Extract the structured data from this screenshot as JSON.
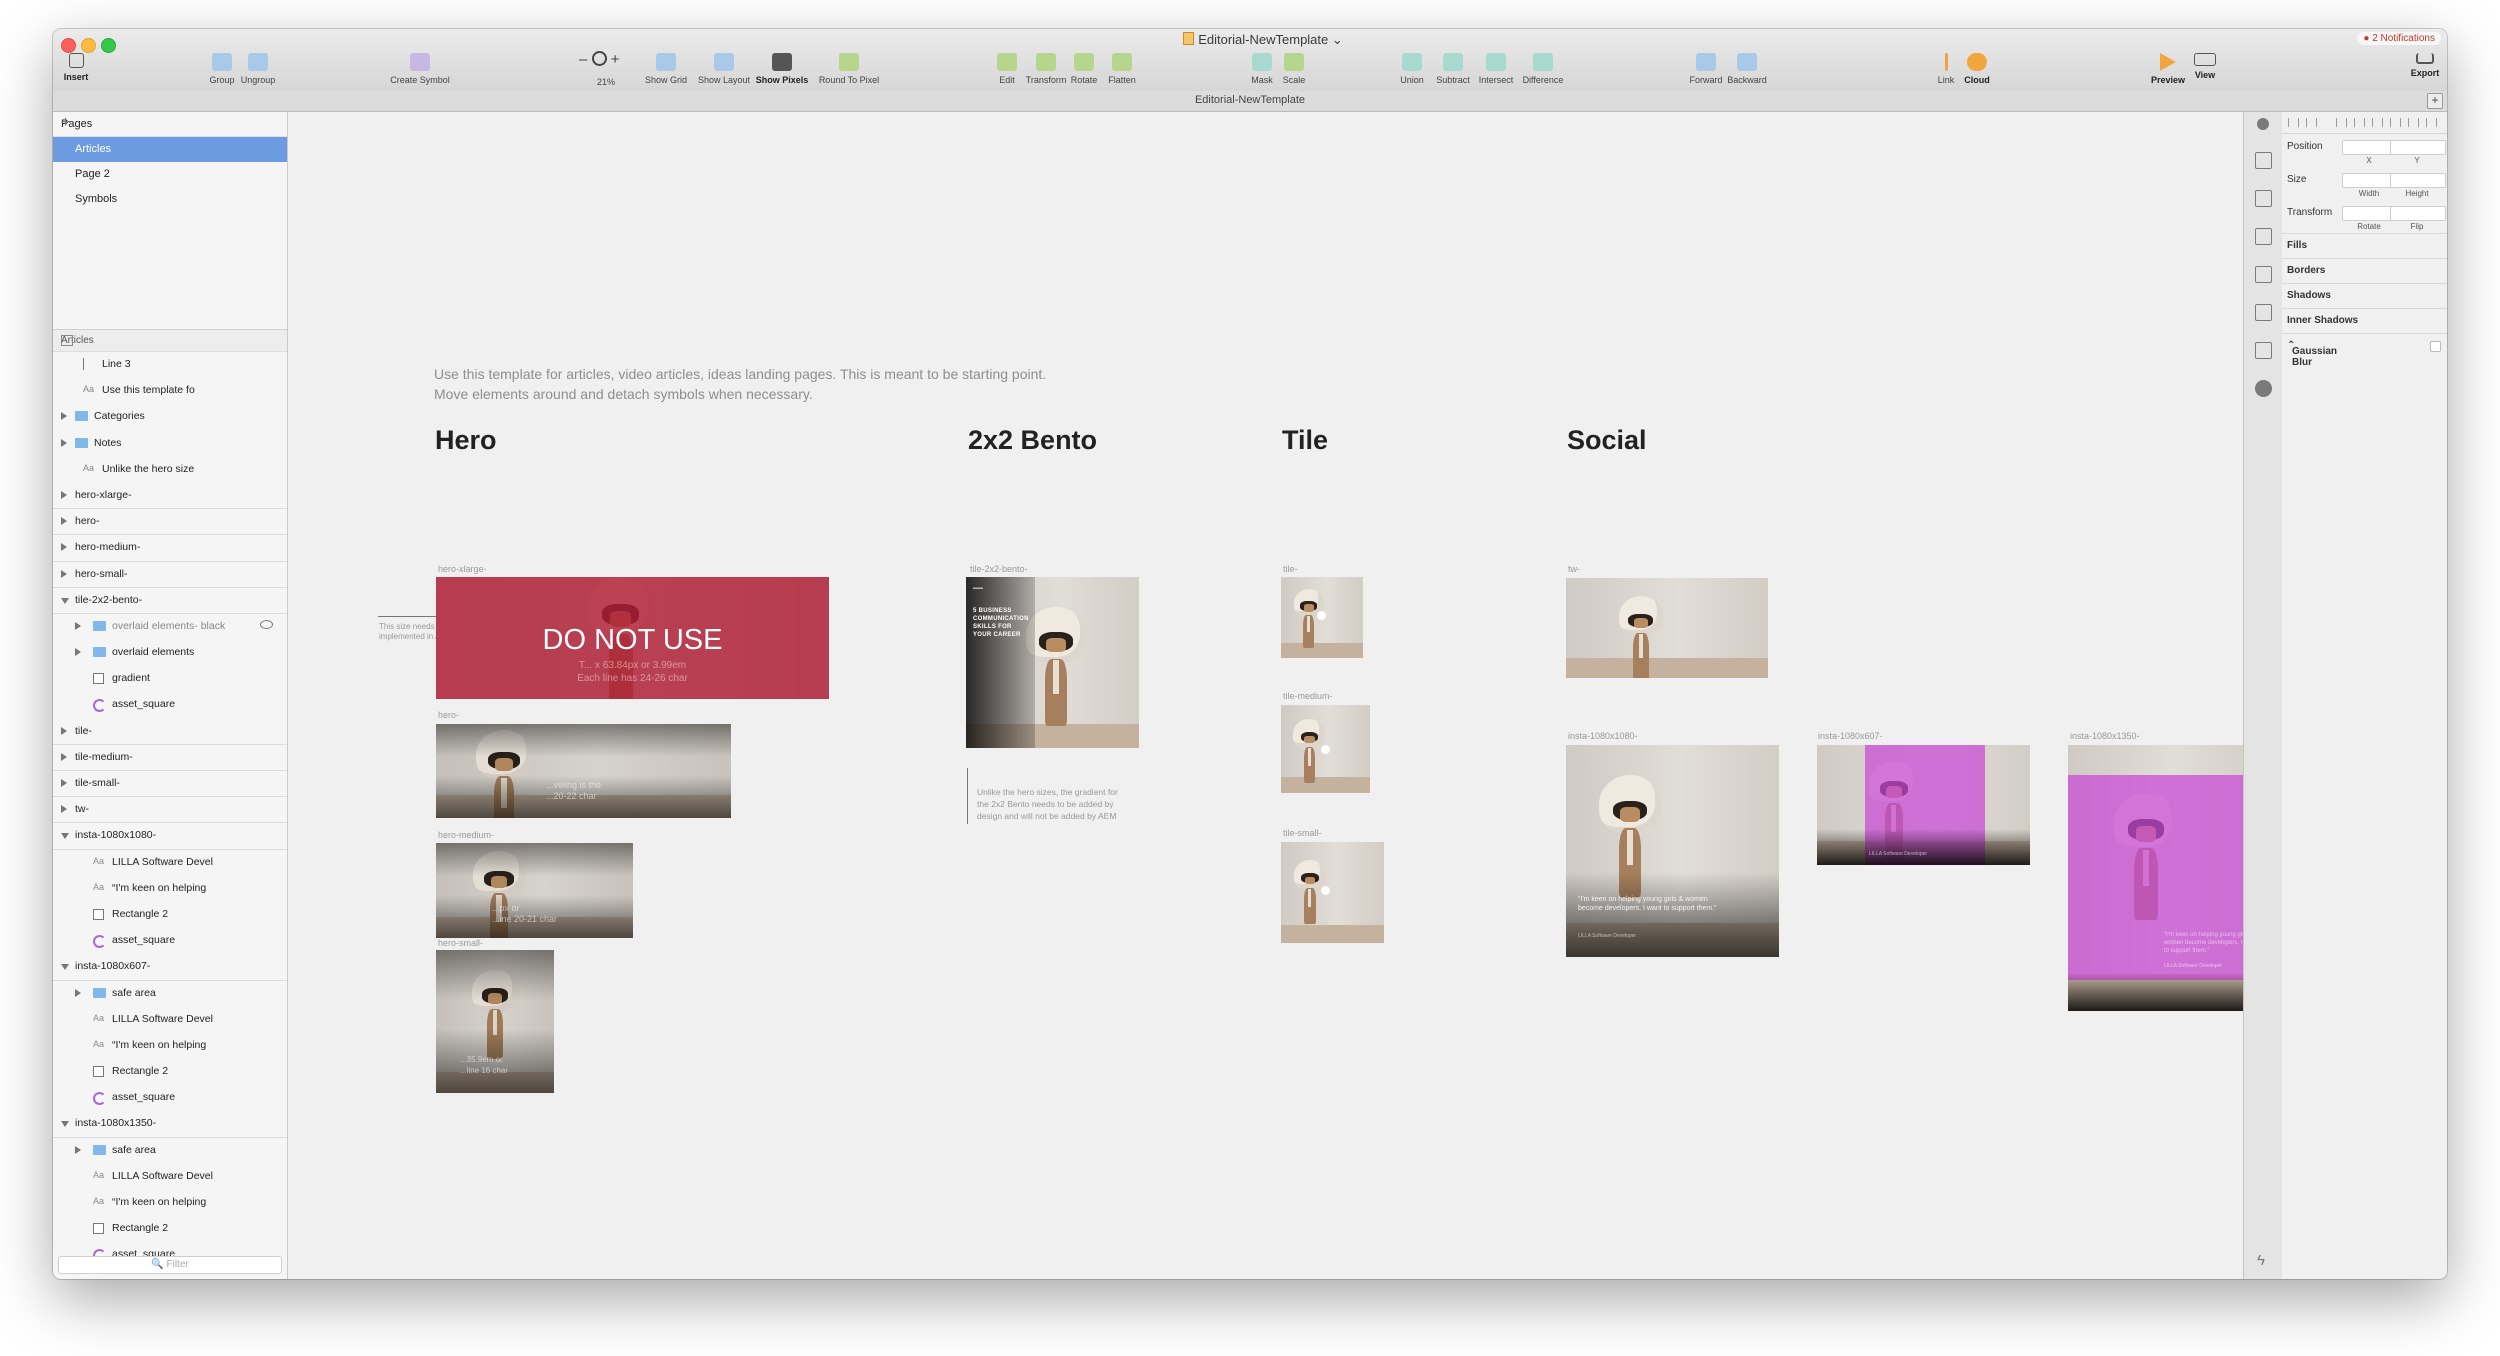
{
  "window": {
    "title": "Editorial-NewTemplate",
    "notifications": "2 Notifications",
    "tab_title": "Editorial-NewTemplate",
    "tab_add": "+"
  },
  "toolbar": {
    "insert": "Insert",
    "group": "Group",
    "ungroup": "Ungroup",
    "create_symbol": "Create Symbol",
    "zoom_minus": "–",
    "zoom_plus": "+",
    "zoom_level": "21%",
    "show_grid": "Show Grid",
    "show_layout": "Show Layout",
    "show_pixels": "Show Pixels",
    "round_to_pixel": "Round To Pixel",
    "edit": "Edit",
    "transform": "Transform",
    "rotate": "Rotate",
    "flatten": "Flatten",
    "mask": "Mask",
    "scale": "Scale",
    "union": "Union",
    "subtract": "Subtract",
    "intersect": "Intersect",
    "difference": "Difference",
    "forward": "Forward",
    "backward": "Backward",
    "link": "Link",
    "cloud": "Cloud",
    "preview": "Preview",
    "view": "View",
    "export": "Export"
  },
  "pages": {
    "header": "Pages",
    "add": "+",
    "items": [
      {
        "label": "Articles",
        "selected": true
      },
      {
        "label": "Page 2",
        "selected": false
      },
      {
        "label": "Symbols",
        "selected": false
      }
    ]
  },
  "layers": {
    "header": "Articles",
    "filter_placeholder": "Filter",
    "items": [
      {
        "label": "Line 3",
        "type": "line",
        "indent": 2,
        "arrow": "none"
      },
      {
        "label": "Use this template fo",
        "type": "text",
        "indent": 2,
        "arrow": "none"
      },
      {
        "label": "Categories",
        "type": "folder",
        "indent": 2,
        "arrow": "closed"
      },
      {
        "label": "Notes",
        "type": "folder",
        "indent": 2,
        "arrow": "closed"
      },
      {
        "label": "Unlike the hero size",
        "type": "text",
        "indent": 2,
        "arrow": "none"
      },
      {
        "label": "hero-xlarge-",
        "type": "artboard",
        "indent": 1,
        "arrow": "closed"
      },
      {
        "label": "hero-",
        "type": "artboard",
        "indent": 1,
        "arrow": "closed"
      },
      {
        "label": "hero-medium-",
        "type": "artboard",
        "indent": 1,
        "arrow": "closed"
      },
      {
        "label": "hero-small-",
        "type": "artboard",
        "indent": 1,
        "arrow": "closed"
      },
      {
        "label": "tile-2x2-bento-",
        "type": "artboard",
        "indent": 1,
        "arrow": "open"
      },
      {
        "label": "overlaid elements- black",
        "type": "folder",
        "indent": 3,
        "arrow": "closed",
        "dim": true,
        "eye": true
      },
      {
        "label": "overlaid elements",
        "type": "folder",
        "indent": 3,
        "arrow": "closed"
      },
      {
        "label": "gradient",
        "type": "rect",
        "indent": 3,
        "arrow": "none"
      },
      {
        "label": "asset_square",
        "type": "symbol",
        "indent": 3,
        "arrow": "none"
      },
      {
        "label": "tile-",
        "type": "artboard",
        "indent": 1,
        "arrow": "closed"
      },
      {
        "label": "tile-medium-",
        "type": "artboard",
        "indent": 1,
        "arrow": "closed"
      },
      {
        "label": "tile-small-",
        "type": "artboard",
        "indent": 1,
        "arrow": "closed"
      },
      {
        "label": "tw-",
        "type": "artboard",
        "indent": 1,
        "arrow": "closed"
      },
      {
        "label": "insta-1080x1080-",
        "type": "artboard",
        "indent": 1,
        "arrow": "open"
      },
      {
        "label": "LILLA Software Devel",
        "type": "text",
        "indent": 3,
        "arrow": "none"
      },
      {
        "label": "“I'm keen on helping",
        "type": "text",
        "indent": 3,
        "arrow": "none"
      },
      {
        "label": "Rectangle 2",
        "type": "rect",
        "indent": 3,
        "arrow": "none"
      },
      {
        "label": "asset_square",
        "type": "symbol",
        "indent": 3,
        "arrow": "none"
      },
      {
        "label": "insta-1080x607-",
        "type": "artboard",
        "indent": 1,
        "arrow": "open"
      },
      {
        "label": "safe area",
        "type": "folder",
        "indent": 3,
        "arrow": "closed"
      },
      {
        "label": "LILLA Software Devel",
        "type": "text",
        "indent": 3,
        "arrow": "none"
      },
      {
        "label": "“I'm keen on helping",
        "type": "text",
        "indent": 3,
        "arrow": "none"
      },
      {
        "label": "Rectangle 2",
        "type": "rect",
        "indent": 3,
        "arrow": "none"
      },
      {
        "label": "asset_square",
        "type": "symbol",
        "indent": 3,
        "arrow": "none"
      },
      {
        "label": "insta-1080x1350-",
        "type": "artboard",
        "indent": 1,
        "arrow": "open"
      },
      {
        "label": "safe area",
        "type": "folder",
        "indent": 3,
        "arrow": "closed"
      },
      {
        "label": "LILLA Software Devel",
        "type": "text",
        "indent": 3,
        "arrow": "none"
      },
      {
        "label": "“I'm keen on helping",
        "type": "text",
        "indent": 3,
        "arrow": "none"
      },
      {
        "label": "Rectangle 2",
        "type": "rect",
        "indent": 3,
        "arrow": "none"
      },
      {
        "label": "asset_square",
        "type": "symbol",
        "indent": 3,
        "arrow": "none"
      }
    ]
  },
  "canvas": {
    "intro_line1": "Use this template for articles, video articles, ideas landing pages. This is meant to be starting point.",
    "intro_line2": "Move elements around and detach symbols when necessary.",
    "sections": {
      "hero": "Hero",
      "bento": "2x2 Bento",
      "tile": "Tile",
      "social": "Social"
    },
    "artboards": {
      "hero_xlarge": "hero-xlarge-",
      "hero": "hero-",
      "hero_medium": "hero-medium-",
      "hero_small": "hero-small-",
      "bento": "tile-2x2-bento-",
      "tile": "tile-",
      "tile_medium": "tile-medium-",
      "tile_small": "tile-small-",
      "tw": "tw-",
      "insta_1080": "insta-1080x1080-",
      "insta_607": "insta-1080x607-",
      "insta_1350": "insta-1080x1350-"
    },
    "hero_xlarge_headline": "DO NOT USE",
    "hero_xlarge_sub1": "T... x 63.84px or 3.99em",
    "hero_xlarge_sub2": "Each line has 24-26 char",
    "hero_text1": "...veling is the",
    "hero_text2": "...20-22 char",
    "hero_medium_text1": "...px or",
    "hero_medium_text2": "...ine 20-21 char",
    "hero_small_text1": "...35.9em or",
    "hero_small_text2": "...line 16 char",
    "bento_head": "5 BUSINESS COMMUNICATION SKILLS FOR YOUR CAREER",
    "insta_1080_quote": "“I'm keen on helping young girls & women become developers. I want to support them.”",
    "insta_1080_credit": "LILLA Software Developer",
    "insta_607_credit": "LILLA Software Developer",
    "insta_1350_quote": "“I'm keen on helping young girls & women become developers. I want to support them.”",
    "insta_1350_credit": "LILLA Software Developer",
    "note_aem": "This size needs to be implemented in AEM.",
    "note_bento1": "Unlike the hero sizes, the gradient for",
    "note_bento2": "the 2x2 Bento needs to be added by",
    "note_bento3": "design and will not be added by AEM"
  },
  "inspector": {
    "position": "Position",
    "x": "X",
    "y": "Y",
    "size": "Size",
    "width": "Width",
    "height": "Height",
    "transform": "Transform",
    "rotate": "Rotate",
    "flip": "Flip",
    "fills": "Fills",
    "borders": "Borders",
    "shadows": "Shadows",
    "inner_shadows": "Inner Shadows",
    "gaussian_blur": "Gaussian Blur"
  },
  "colors": {
    "selection": "#6d9be2",
    "tint_red": "#b01c34",
    "tint_pink": "#c747d6"
  }
}
